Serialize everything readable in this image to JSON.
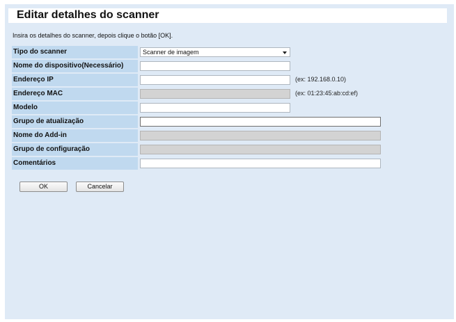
{
  "title": "Editar detalhes do scanner",
  "instruction": "Insira os detalhes do scanner, depois clique o botão [OK].",
  "form": {
    "scanner_type": {
      "label": "Tipo do scanner",
      "selected": "Scanner de imagem"
    },
    "device_name": {
      "label": "Nome do dispositivo(Necessário)",
      "value": ""
    },
    "ip_address": {
      "label": "Endereço IP",
      "value": "",
      "hint": "(ex: 192.168.0.10)"
    },
    "mac_address": {
      "label": "Endereço MAC",
      "value": "",
      "hint": "(ex: 01:23:45:ab:cd:ef)"
    },
    "model": {
      "label": "Modelo",
      "value": ""
    },
    "update_group": {
      "label": "Grupo de atualização",
      "value": ""
    },
    "addin_name": {
      "label": "Nome do Add-in",
      "value": ""
    },
    "config_group": {
      "label": "Grupo de configuração",
      "value": ""
    },
    "comments": {
      "label": "Comentários",
      "value": ""
    }
  },
  "buttons": {
    "ok": "OK",
    "cancel": "Cancelar"
  },
  "colors": {
    "page_background": "#dfeaf6",
    "label_background": "#c0d9ef",
    "disabled_field": "#d3d3d3"
  }
}
